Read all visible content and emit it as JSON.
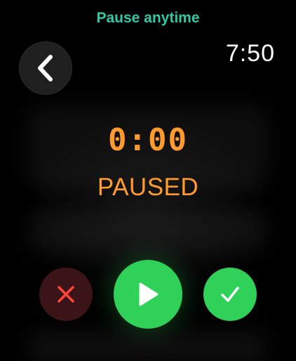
{
  "hint": {
    "text": "Pause anytime"
  },
  "clock": {
    "time": "7:50"
  },
  "timer": {
    "elapsed": "0:00",
    "state": "PAUSED"
  },
  "icons": {
    "back": "chevron-left-icon",
    "cancel": "x-icon",
    "play": "play-icon",
    "done": "checkmark-icon"
  },
  "colors": {
    "hint": "#2fc9a6",
    "timer": "#ff9a2e",
    "accent_green": "#30d158",
    "cancel_bg": "#3a1416",
    "cancel_icon": "#ff453a"
  }
}
